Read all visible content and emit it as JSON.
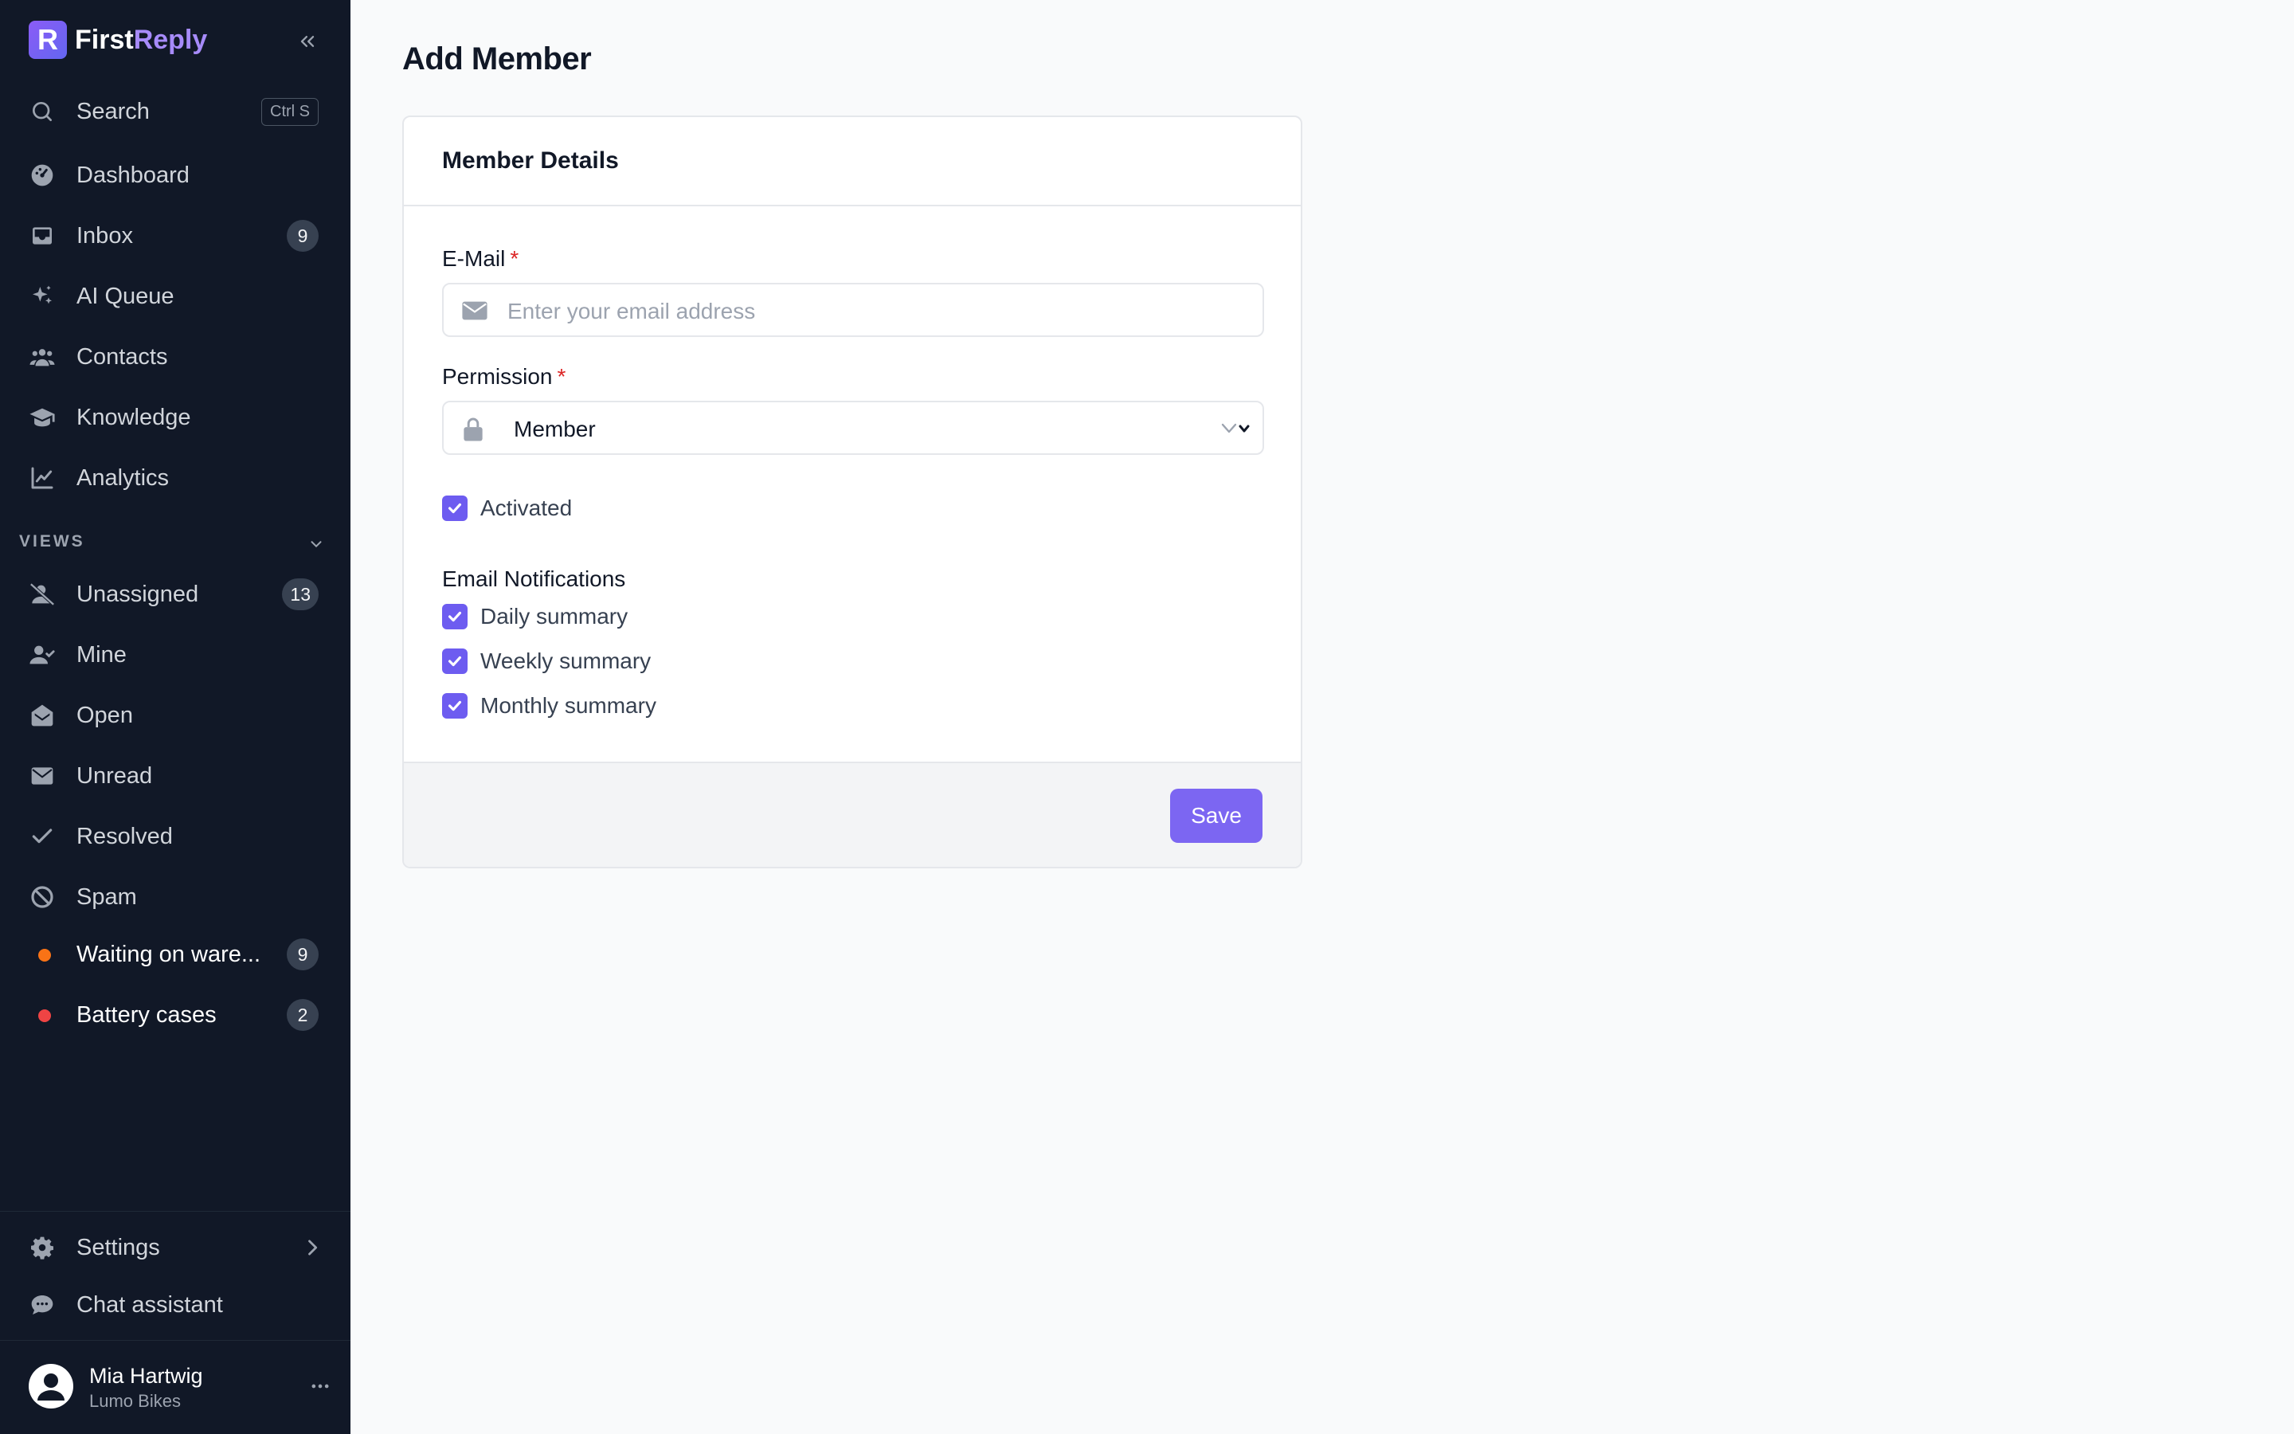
{
  "brand": {
    "name_part1": "First",
    "name_part2": "Reply",
    "logo_letter": "R"
  },
  "search": {
    "label": "Search",
    "shortcut": "Ctrl S"
  },
  "nav": {
    "items": [
      {
        "label": "Dashboard",
        "icon": "dashboard-icon"
      },
      {
        "label": "Inbox",
        "icon": "inbox-icon",
        "badge": "9"
      },
      {
        "label": "AI Queue",
        "icon": "sparkles-icon"
      },
      {
        "label": "Contacts",
        "icon": "users-icon"
      },
      {
        "label": "Knowledge",
        "icon": "graduation-cap-icon"
      },
      {
        "label": "Analytics",
        "icon": "chart-line-icon"
      }
    ]
  },
  "views": {
    "heading": "VIEWS",
    "items": [
      {
        "label": "Unassigned",
        "icon": "user-slash-icon",
        "badge": "13"
      },
      {
        "label": "Mine",
        "icon": "user-check-icon"
      },
      {
        "label": "Open",
        "icon": "envelope-open-icon"
      },
      {
        "label": "Unread",
        "icon": "envelope-icon"
      },
      {
        "label": "Resolved",
        "icon": "check-icon"
      },
      {
        "label": "Spam",
        "icon": "ban-icon"
      },
      {
        "label": "Waiting on ware...",
        "dot_color": "#f97316",
        "badge": "9"
      },
      {
        "label": "Battery cases",
        "dot_color": "#ef4444",
        "badge": "2"
      }
    ]
  },
  "footer_nav": {
    "settings": "Settings",
    "chat": "Chat assistant"
  },
  "user": {
    "name": "Mia Hartwig",
    "org": "Lumo Bikes"
  },
  "page": {
    "title": "Add Member"
  },
  "card": {
    "title": "Member Details",
    "email_label": "E-Mail",
    "email_placeholder": "Enter your email address",
    "permission_label": "Permission",
    "permission_value": "Member",
    "required_mark": "*",
    "activated_label": "Activated",
    "activated_checked": true,
    "notifications_heading": "Email Notifications",
    "notifications": [
      {
        "label": "Daily summary",
        "checked": true
      },
      {
        "label": "Weekly summary",
        "checked": true
      },
      {
        "label": "Monthly summary",
        "checked": true
      }
    ],
    "save_label": "Save"
  },
  "colors": {
    "sidebar_bg": "#111827",
    "accent": "#7c66f2",
    "page_bg": "#f9fafb",
    "required": "#dc2626"
  }
}
